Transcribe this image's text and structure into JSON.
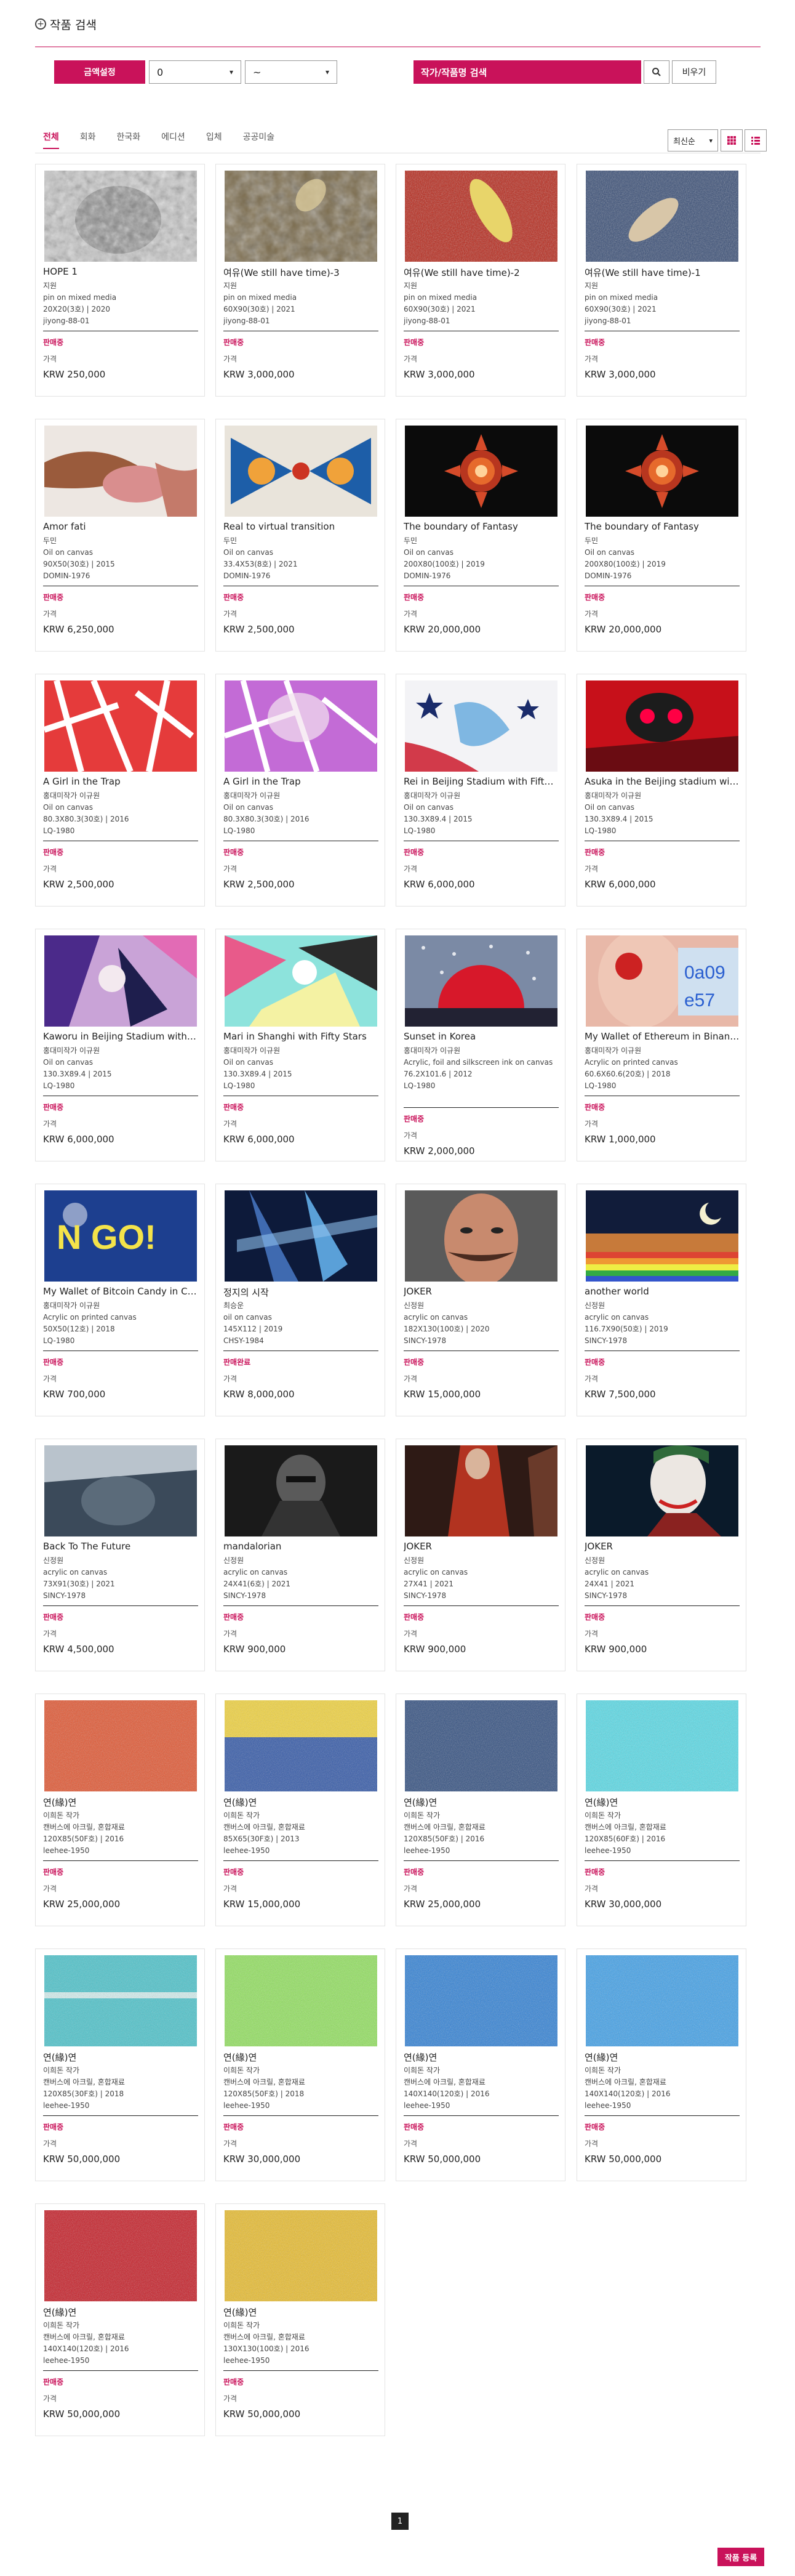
{
  "header": {
    "title": "작품 검색"
  },
  "filter": {
    "price_button": "금액설정",
    "min_value": "0",
    "max_value": "~",
    "search_placeholder": "작가/작품명 검색",
    "clear_label": "비우기"
  },
  "tabs": [
    {
      "label": "전체",
      "active": true
    },
    {
      "label": "회화"
    },
    {
      "label": "한국화"
    },
    {
      "label": "에디션"
    },
    {
      "label": "입체"
    },
    {
      "label": "공공미술"
    }
  ],
  "sort": {
    "selected": "최신순"
  },
  "card_labels": {
    "price_label": "가격"
  },
  "artworks": [
    {
      "title": "HOPE 1",
      "artist": "지원",
      "medium": "pin on mixed media",
      "spec": "20X20(3호) | 2020",
      "seller": "jiyong-88-01",
      "status": "판매중",
      "price": "KRW 250,000",
      "art": "hope"
    },
    {
      "title": "여유(We still have time)-3",
      "artist": "지원",
      "medium": "pin on mixed media",
      "spec": "60X90(30호) | 2021",
      "seller": "jiyong-88-01",
      "status": "판매중",
      "price": "KRW 3,000,000",
      "art": "yeoyu3"
    },
    {
      "title": "여유(We still have time)-2",
      "artist": "지원",
      "medium": "pin on mixed media",
      "spec": "60X90(30호) | 2021",
      "seller": "jiyong-88-01",
      "status": "판매중",
      "price": "KRW 3,000,000",
      "art": "yeoyu2"
    },
    {
      "title": "여유(We still have time)-1",
      "artist": "지원",
      "medium": "pin on mixed media",
      "spec": "60X90(30호) | 2021",
      "seller": "jiyong-88-01",
      "status": "판매중",
      "price": "KRW 3,000,000",
      "art": "yeoyu1"
    },
    {
      "title": "Amor fati",
      "artist": "두민",
      "medium": "Oil on canvas",
      "spec": "90X50(30호) | 2015",
      "seller": "DOMIN-1976",
      "status": "판매중",
      "price": "KRW 6,250,000",
      "art": "amor"
    },
    {
      "title": "Real to virtual transition",
      "artist": "두민",
      "medium": "Oil on canvas",
      "spec": "33.4X53(8호) | 2021",
      "seller": "DOMIN-1976",
      "status": "판매중",
      "price": "KRW 2,500,000",
      "art": "real"
    },
    {
      "title": "The boundary of Fantasy",
      "artist": "두민",
      "medium": "Oil on canvas",
      "spec": "200X80(100호) | 2019",
      "seller": "DOMIN-1976",
      "status": "판매중",
      "price": "KRW 20,000,000",
      "art": "fantasy"
    },
    {
      "title": "The boundary of Fantasy",
      "artist": "두민",
      "medium": "Oil on canvas",
      "spec": "200X80(100호) | 2019",
      "seller": "DOMIN-1976",
      "status": "판매중",
      "price": "KRW 20,000,000",
      "art": "fantasy"
    },
    {
      "title": "A Girl in the Trap",
      "artist": "홍대미작가 이규원",
      "medium": "Oil on canvas",
      "spec": "80.3X80.3(30호) | 2016",
      "seller": "LQ-1980",
      "status": "판매중",
      "price": "KRW 2,500,000",
      "art": "trap1"
    },
    {
      "title": "A Girl in the Trap",
      "artist": "홍대미작가 이규원",
      "medium": "Oil on canvas",
      "spec": "80.3X80.3(30호) | 2016",
      "seller": "LQ-1980",
      "status": "판매중",
      "price": "KRW 2,500,000",
      "art": "trap2"
    },
    {
      "title": "Rei in Beijing Stadium with Fifty Stars",
      "artist": "홍대미작가 이규원",
      "medium": "Oil on canvas",
      "spec": "130.3X89.4 | 2015",
      "seller": "LQ-1980",
      "status": "판매중",
      "price": "KRW 6,000,000",
      "art": "rei"
    },
    {
      "title": "Asuka in the Beijing stadium with Fifty Stars",
      "artist": "홍대미작가 이규원",
      "medium": "Oil on canvas",
      "spec": "130.3X89.4 | 2015",
      "seller": "LQ-1980",
      "status": "판매중",
      "price": "KRW 6,000,000",
      "art": "asuka"
    },
    {
      "title": "Kaworu in Beijing Stadium with Fifty Stars",
      "artist": "홍대미작가 이규원",
      "medium": "Oil on canvas",
      "spec": "130.3X89.4 | 2015",
      "seller": "LQ-1980",
      "status": "판매중",
      "price": "KRW 6,000,000",
      "art": "kaworu"
    },
    {
      "title": "Mari in Shanghi with Fifty Stars",
      "artist": "홍대미작가 이규원",
      "medium": "Oil on canvas",
      "spec": "130.3X89.4 | 2015",
      "seller": "LQ-1980",
      "status": "판매중",
      "price": "KRW 6,000,000",
      "art": "mari"
    },
    {
      "title": "Sunset in Korea",
      "artist": "홍대미작가 이규원",
      "medium": "Acrylic, foil and silkscreen ink on canvas",
      "spec": "76.2X101.6 | 2012",
      "seller": "LQ-1980",
      "status": "판매중",
      "price": "KRW 2,000,000",
      "art": "sunset"
    },
    {
      "title": "My Wallet of Ethereum in Binance",
      "artist": "홍대미작가 이규원",
      "medium": "Acrylic on printed canvas",
      "spec": "60.6X60.6(20호) | 2018",
      "seller": "LQ-1980",
      "status": "판매중",
      "price": "KRW 1,000,000",
      "art": "wallet_eth"
    },
    {
      "title": "My Wallet of Bitcoin Candy in Coinbase",
      "artist": "홍대미작가 이규원",
      "medium": "Acrylic on printed canvas",
      "spec": "50X50(12호) | 2018",
      "seller": "LQ-1980",
      "status": "판매중",
      "price": "KRW 700,000",
      "art": "wallet_btc"
    },
    {
      "title": "정지의 시작",
      "artist": "최승운",
      "medium": "oil on canvas",
      "spec": "145X112 | 2019",
      "seller": "CHSY-1984",
      "status": "판매완료",
      "price": "KRW 8,000,000",
      "art": "jeongji"
    },
    {
      "title": "JOKER",
      "artist": "신정원",
      "medium": "acrylic on canvas",
      "spec": "182X130(100호) | 2020",
      "seller": "SINCY-1978",
      "status": "판매중",
      "price": "KRW 15,000,000",
      "art": "joker_face"
    },
    {
      "title": "another world",
      "artist": "신정원",
      "medium": "acrylic on canvas",
      "spec": "116.7X90(50호) | 2019",
      "seller": "SINCY-1978",
      "status": "판매중",
      "price": "KRW 7,500,000",
      "art": "another"
    },
    {
      "title": "Back To The Future",
      "artist": "신정원",
      "medium": "acrylic on canvas",
      "spec": "73X91(30호) | 2021",
      "seller": "SINCY-1978",
      "status": "판매중",
      "price": "KRW 4,500,000",
      "art": "bttf"
    },
    {
      "title": "mandalorian",
      "artist": "신정원",
      "medium": "acrylic on canvas",
      "spec": "24X41(6호) | 2021",
      "seller": "SINCY-1978",
      "status": "판매중",
      "price": "KRW 900,000",
      "art": "mando"
    },
    {
      "title": "JOKER",
      "artist": "신정원",
      "medium": "acrylic on canvas",
      "spec": "27X41 | 2021",
      "seller": "SINCY-1978",
      "status": "판매중",
      "price": "KRW 900,000",
      "art": "joker_red"
    },
    {
      "title": "JOKER",
      "artist": "신정원",
      "medium": "acrylic on canvas",
      "spec": "24X41 | 2021",
      "seller": "SINCY-1978",
      "status": "판매중",
      "price": "KRW 900,000",
      "art": "joker_dark"
    },
    {
      "title": "연(緣)연",
      "artist": "이희돈 작가",
      "medium": "캔버스에 아크릴, 혼합재료",
      "spec": "120X85(50F호) | 2016",
      "seller": "leehee-1950",
      "status": "판매중",
      "price": "KRW 25,000,000",
      "art": "tex_orange"
    },
    {
      "title": "연(緣)연",
      "artist": "이희돈 작가",
      "medium": "캔버스에 아크릴, 혼합재료",
      "spec": "85X65(30F호) | 2013",
      "seller": "leehee-1950",
      "status": "판매중",
      "price": "KRW 15,000,000",
      "art": "tex_yellowblue"
    },
    {
      "title": "연(緣)연",
      "artist": "이희돈 작가",
      "medium": "캔버스에 아크릴, 혼합재료",
      "spec": "120X85(50F호) | 2016",
      "seller": "leehee-1950",
      "status": "판매중",
      "price": "KRW 25,000,000",
      "art": "tex_navy"
    },
    {
      "title": "연(緣)연",
      "artist": "이희돈 작가",
      "medium": "캔버스에 아크릴, 혼합재료",
      "spec": "120X85(60F호) | 2016",
      "seller": "leehee-1950",
      "status": "판매중",
      "price": "KRW 30,000,000",
      "art": "tex_cyan"
    },
    {
      "title": "연(緣)연",
      "artist": "이희돈 작가",
      "medium": "캔버스에 아크릴, 혼합재료",
      "spec": "120X85(30F호) | 2018",
      "seller": "leehee-1950",
      "status": "판매중",
      "price": "KRW 50,000,000",
      "art": "tex_teal"
    },
    {
      "title": "연(緣)연",
      "artist": "이희돈 작가",
      "medium": "캔버스에 아크릴, 혼합재료",
      "spec": "120X85(50F호) | 2018",
      "seller": "leehee-1950",
      "status": "판매중",
      "price": "KRW 30,000,000",
      "art": "tex_green"
    },
    {
      "title": "연(緣)연",
      "artist": "이희돈 작가",
      "medium": "캔버스에 아크릴, 혼합재료",
      "spec": "140X140(120호) | 2016",
      "seller": "leehee-1950",
      "status": "판매중",
      "price": "KRW 50,000,000",
      "art": "tex_blue"
    },
    {
      "title": "연(緣)연",
      "artist": "이희돈 작가",
      "medium": "캔버스에 아크릴, 혼합재료",
      "spec": "140X140(120호) | 2016",
      "seller": "leehee-1950",
      "status": "판매중",
      "price": "KRW 50,000,000",
      "art": "tex_lightblue"
    },
    {
      "title": "연(緣)연",
      "artist": "이희돈 작가",
      "medium": "캔버스에 아크릴, 혼합재료",
      "spec": "140X140(120호) | 2016",
      "seller": "leehee-1950",
      "status": "판매중",
      "price": "KRW 50,000,000",
      "art": "tex_red"
    },
    {
      "title": "연(緣)연",
      "artist": "이희돈 작가",
      "medium": "캔버스에 아크릴, 혼합재료",
      "spec": "130X130(100호) | 2016",
      "seller": "leehee-1950",
      "status": "판매중",
      "price": "KRW 50,000,000",
      "art": "tex_gold"
    }
  ],
  "pagination": {
    "current": "1"
  },
  "register": {
    "label": "작품 등록"
  },
  "colors": {
    "accent": "#c9125a"
  }
}
